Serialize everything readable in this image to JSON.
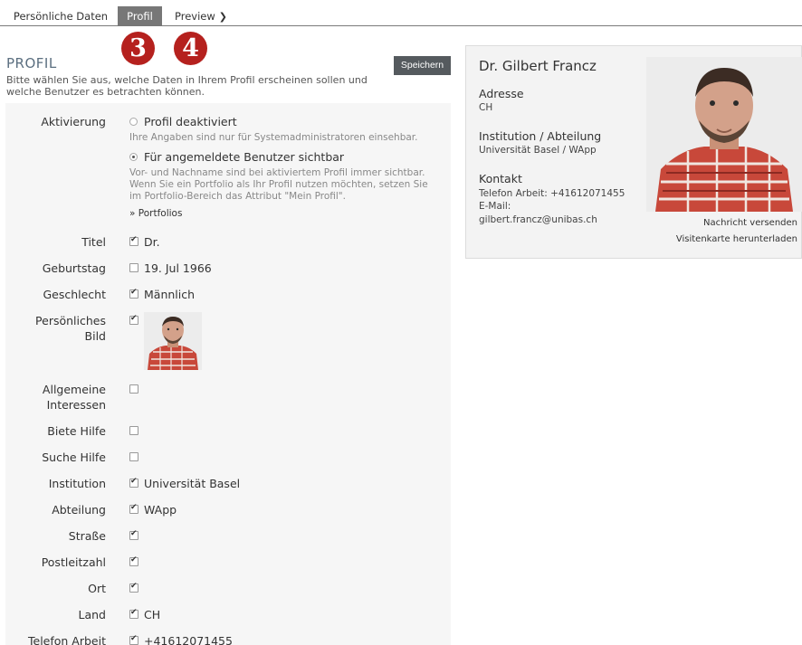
{
  "tabs": [
    {
      "label": "Persönliche Daten"
    },
    {
      "label": "Profil"
    },
    {
      "label": "Preview"
    }
  ],
  "steps": [
    "3",
    "4"
  ],
  "header": {
    "title": "PROFIL",
    "description": "Bitte wählen Sie aus, welche Daten in Ihrem Profil erscheinen sollen und welche Benutzer es betrachten können.",
    "save_label": "Speichern"
  },
  "activation": {
    "label": "Aktivierung",
    "option1": "Profil deaktiviert",
    "option1_hint": "Ihre Angaben sind nur für Systemadministratoren einsehbar.",
    "option2": "Für angemeldete Benutzer sichtbar",
    "option2_hint": "Vor- und Nachname sind bei aktiviertem Profil immer sichtbar. Wenn Sie ein Portfolio als Ihr Profil nutzen möchten, setzen Sie im Portfolio-Bereich das Attribut \"Mein Profil\".",
    "portfolio_link": "» Portfolios"
  },
  "fields": [
    {
      "label": "Titel",
      "checked": true,
      "value": "Dr."
    },
    {
      "label": "Geburtstag",
      "checked": false,
      "value": "19. Jul 1966"
    },
    {
      "label": "Geschlecht",
      "checked": true,
      "value": "Männlich"
    },
    {
      "label": "Persönliches Bild",
      "checked": true,
      "value": ""
    },
    {
      "label": "Allgemeine Interessen",
      "checked": false,
      "value": ""
    },
    {
      "label": "Biete Hilfe",
      "checked": false,
      "value": ""
    },
    {
      "label": "Suche Hilfe",
      "checked": false,
      "value": ""
    },
    {
      "label": "Institution",
      "checked": true,
      "value": "Universität Basel"
    },
    {
      "label": "Abteilung",
      "checked": true,
      "value": "WApp"
    },
    {
      "label": "Straße",
      "checked": true,
      "value": ""
    },
    {
      "label": "Postleitzahl",
      "checked": true,
      "value": ""
    },
    {
      "label": "Ort",
      "checked": true,
      "value": ""
    },
    {
      "label": "Land",
      "checked": true,
      "value": "CH"
    },
    {
      "label": "Telefon Arbeit",
      "checked": true,
      "value": "+41612071455"
    }
  ],
  "card": {
    "name": "Dr. Gilbert Francz",
    "address_label": "Adresse",
    "address_value": "CH",
    "institution_label": "Institution / Abteilung",
    "institution_value": "Universität Basel / WApp",
    "contact_label": "Kontakt",
    "phone_line": "Telefon Arbeit: +41612071455",
    "email_label": "E-Mail:",
    "email_value": "gilbert.francz@unibas.ch",
    "send_message": "Nachricht versenden",
    "download_card": "Visitenkarte herunterladen"
  }
}
